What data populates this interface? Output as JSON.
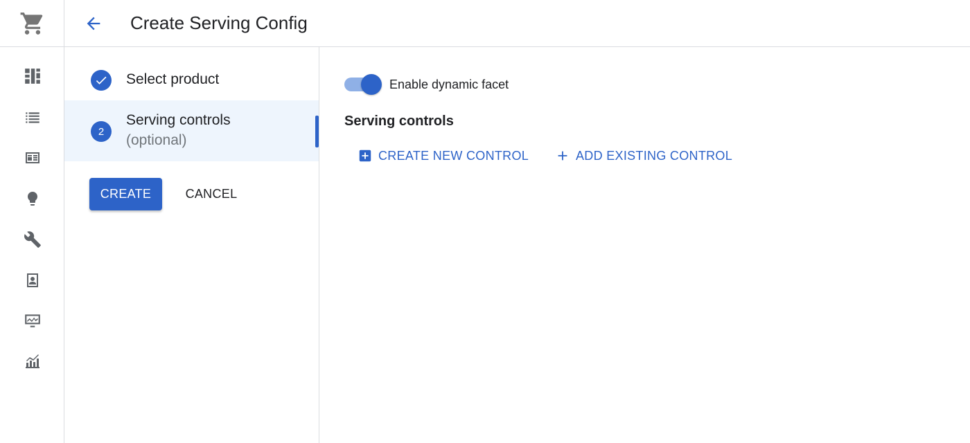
{
  "header": {
    "title": "Create Serving Config"
  },
  "rail": {
    "items": [
      {
        "icon": "cart-icon"
      },
      {
        "icon": "dashboard-icon"
      },
      {
        "icon": "list-icon"
      },
      {
        "icon": "catalog-icon"
      },
      {
        "icon": "lightbulb-icon"
      },
      {
        "icon": "wrench-icon"
      },
      {
        "icon": "contacts-icon"
      },
      {
        "icon": "monitor-icon"
      },
      {
        "icon": "analytics-icon"
      }
    ]
  },
  "stepper": {
    "steps": [
      {
        "number": "",
        "label": "Select product",
        "sublabel": "",
        "status": "complete"
      },
      {
        "number": "2",
        "label": "Serving controls",
        "sublabel": "(optional)",
        "status": "active"
      }
    ],
    "create_label": "CREATE",
    "cancel_label": "CANCEL"
  },
  "main": {
    "toggle_label": "Enable dynamic facet",
    "toggle_on": true,
    "section_title": "Serving controls",
    "create_control_label": "CREATE NEW CONTROL",
    "add_control_label": "ADD EXISTING CONTROL"
  },
  "colors": {
    "primary": "#2d63c8",
    "active_step_bg": "#eef5fd",
    "icon_gray": "#5f6368"
  }
}
